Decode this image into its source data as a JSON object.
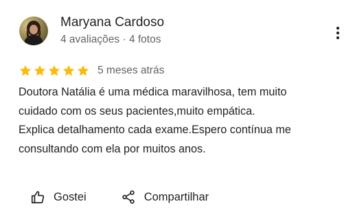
{
  "review": {
    "author": {
      "name": "Maryana Cardoso",
      "meta": "4 avaliações · 4 fotos"
    },
    "rating": {
      "stars": 5,
      "max": 5,
      "star_color": "#f9bb0c"
    },
    "date": "5 meses atrás",
    "text_lines": [
      "Doutora Natália é uma médica maravilhosa, tem muito",
      "cuidado com os seus pacientes,muito empática.",
      "Explica detalhamento cada exame.Espero contínua me",
      "consultando com ela por muitos anos."
    ],
    "actions": {
      "like_label": "Gostei",
      "like_icon": "thumbs-up-icon",
      "share_label": "Compartilhar",
      "share_icon": "share-icon"
    },
    "more_icon": "more-vert-icon"
  }
}
